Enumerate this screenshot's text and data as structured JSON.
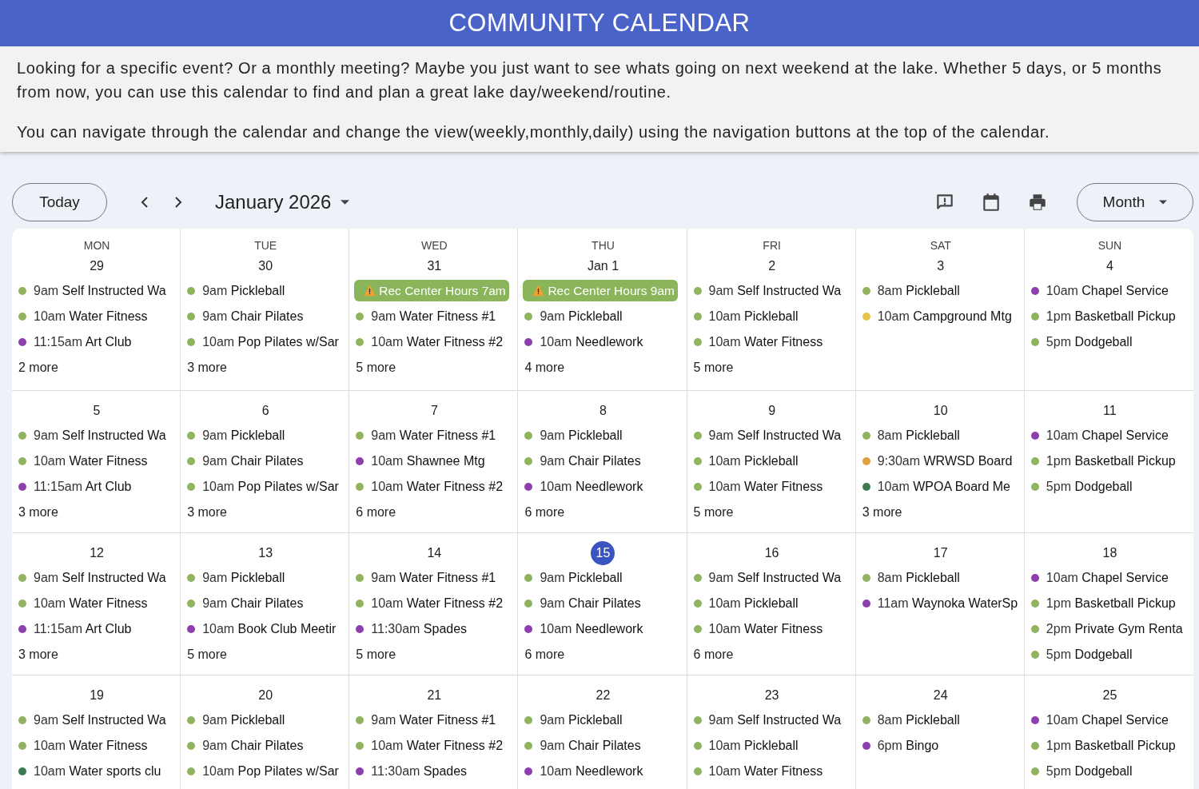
{
  "header": {
    "title": "COMMUNITY CALENDAR"
  },
  "intro": {
    "paragraphs": [
      "Looking for a specific event? Or a monthly meeting? Maybe you just want to see whats going on next weekend at the lake. Whether 5 days, or 5 months from now, you can use this calendar to find and plan a great lake day/weekend/routine.",
      "You can navigate through the calendar and change the view(weekly,monthly,daily) using the navigation buttons at the top of the calendar."
    ]
  },
  "toolbar": {
    "today_button": "Today",
    "month_title": "January 2026",
    "view_button": "Month"
  },
  "weekdays": [
    "MON",
    "TUE",
    "WED",
    "THU",
    "FRI",
    "SAT",
    "SUN"
  ],
  "weeks": [
    {
      "days": [
        {
          "date": "29",
          "today": false,
          "more": "2 more",
          "events": [
            {
              "kind": "dot",
              "color": "#8fb35f",
              "time": "9am",
              "title": "Self Instructed Wa"
            },
            {
              "kind": "dot",
              "color": "#8fb35f",
              "time": "10am",
              "title": "Water Fitness"
            },
            {
              "kind": "dot",
              "color": "#8e3fae",
              "time": "11:15am",
              "title": "Art Club"
            }
          ]
        },
        {
          "date": "30",
          "today": false,
          "more": "3 more",
          "events": [
            {
              "kind": "dot",
              "color": "#8fb35f",
              "time": "9am",
              "title": "Pickleball"
            },
            {
              "kind": "dot",
              "color": "#8fb35f",
              "time": "9am",
              "title": "Chair Pilates"
            },
            {
              "kind": "dot",
              "color": "#8fb35f",
              "time": "10am",
              "title": "Pop Pilates w/Sar"
            }
          ]
        },
        {
          "date": "31",
          "today": false,
          "more": "5 more",
          "events": [
            {
              "kind": "chip",
              "color": "#8bb55a",
              "title": "Rec Center Hours 7am"
            },
            {
              "kind": "dot",
              "color": "#8fb35f",
              "time": "9am",
              "title": "Water Fitness #1"
            },
            {
              "kind": "dot",
              "color": "#8fb35f",
              "time": "10am",
              "title": "Water Fitness #2"
            }
          ]
        },
        {
          "date": "Jan 1",
          "today": false,
          "more": "4 more",
          "events": [
            {
              "kind": "chip",
              "color": "#8bb55a",
              "title": "Rec Center Hours 9am"
            },
            {
              "kind": "dot",
              "color": "#8fb35f",
              "time": "9am",
              "title": "Pickleball"
            },
            {
              "kind": "dot",
              "color": "#8e3fae",
              "time": "10am",
              "title": "Needlework"
            }
          ]
        },
        {
          "date": "2",
          "today": false,
          "more": "5 more",
          "events": [
            {
              "kind": "dot",
              "color": "#8fb35f",
              "time": "9am",
              "title": "Self Instructed Wa"
            },
            {
              "kind": "dot",
              "color": "#8fb35f",
              "time": "10am",
              "title": "Pickleball"
            },
            {
              "kind": "dot",
              "color": "#8fb35f",
              "time": "10am",
              "title": "Water Fitness"
            }
          ]
        },
        {
          "date": "3",
          "today": false,
          "events": [
            {
              "kind": "dot",
              "color": "#8fb35f",
              "time": "8am",
              "title": "Pickleball"
            },
            {
              "kind": "dot",
              "color": "#e8c24a",
              "time": "10am",
              "title": "Campground Mtg"
            }
          ]
        },
        {
          "date": "4",
          "today": false,
          "events": [
            {
              "kind": "dot",
              "color": "#8e3fae",
              "time": "10am",
              "title": "Chapel Service"
            },
            {
              "kind": "dot",
              "color": "#8fb35f",
              "time": "1pm",
              "title": "Basketball Pickup"
            },
            {
              "kind": "dot",
              "color": "#8fb35f",
              "time": "5pm",
              "title": "Dodgeball"
            }
          ]
        }
      ]
    },
    {
      "days": [
        {
          "date": "5",
          "today": false,
          "more": "3 more",
          "events": [
            {
              "kind": "dot",
              "color": "#8fb35f",
              "time": "9am",
              "title": "Self Instructed Wa"
            },
            {
              "kind": "dot",
              "color": "#8fb35f",
              "time": "10am",
              "title": "Water Fitness"
            },
            {
              "kind": "dot",
              "color": "#8e3fae",
              "time": "11:15am",
              "title": "Art Club"
            }
          ]
        },
        {
          "date": "6",
          "today": false,
          "more": "3 more",
          "events": [
            {
              "kind": "dot",
              "color": "#8fb35f",
              "time": "9am",
              "title": "Pickleball"
            },
            {
              "kind": "dot",
              "color": "#8fb35f",
              "time": "9am",
              "title": "Chair Pilates"
            },
            {
              "kind": "dot",
              "color": "#8fb35f",
              "time": "10am",
              "title": "Pop Pilates w/Sar"
            }
          ]
        },
        {
          "date": "7",
          "today": false,
          "more": "6 more",
          "events": [
            {
              "kind": "dot",
              "color": "#8fb35f",
              "time": "9am",
              "title": "Water Fitness #1"
            },
            {
              "kind": "dot",
              "color": "#8e3fae",
              "time": "10am",
              "title": "Shawnee Mtg"
            },
            {
              "kind": "dot",
              "color": "#8fb35f",
              "time": "10am",
              "title": "Water Fitness #2"
            }
          ]
        },
        {
          "date": "8",
          "today": false,
          "more": "6 more",
          "events": [
            {
              "kind": "dot",
              "color": "#8fb35f",
              "time": "9am",
              "title": "Pickleball"
            },
            {
              "kind": "dot",
              "color": "#8fb35f",
              "time": "9am",
              "title": "Chair Pilates"
            },
            {
              "kind": "dot",
              "color": "#8e3fae",
              "time": "10am",
              "title": "Needlework"
            }
          ]
        },
        {
          "date": "9",
          "today": false,
          "more": "5 more",
          "events": [
            {
              "kind": "dot",
              "color": "#8fb35f",
              "time": "9am",
              "title": "Self Instructed Wa"
            },
            {
              "kind": "dot",
              "color": "#8fb35f",
              "time": "10am",
              "title": "Pickleball"
            },
            {
              "kind": "dot",
              "color": "#8fb35f",
              "time": "10am",
              "title": "Water Fitness"
            }
          ]
        },
        {
          "date": "10",
          "today": false,
          "more": "3 more",
          "events": [
            {
              "kind": "dot",
              "color": "#8fb35f",
              "time": "8am",
              "title": "Pickleball"
            },
            {
              "kind": "dot",
              "color": "#e0a040",
              "time": "9:30am",
              "title": "WRWSD Board"
            },
            {
              "kind": "dot",
              "color": "#3d7a4f",
              "time": "10am",
              "title": "WPOA Board Me"
            }
          ]
        },
        {
          "date": "11",
          "today": false,
          "events": [
            {
              "kind": "dot",
              "color": "#8e3fae",
              "time": "10am",
              "title": "Chapel Service"
            },
            {
              "kind": "dot",
              "color": "#8fb35f",
              "time": "1pm",
              "title": "Basketball Pickup"
            },
            {
              "kind": "dot",
              "color": "#8fb35f",
              "time": "5pm",
              "title": "Dodgeball"
            }
          ]
        }
      ]
    },
    {
      "days": [
        {
          "date": "12",
          "today": false,
          "more": "3 more",
          "events": [
            {
              "kind": "dot",
              "color": "#8fb35f",
              "time": "9am",
              "title": "Self Instructed Wa"
            },
            {
              "kind": "dot",
              "color": "#8fb35f",
              "time": "10am",
              "title": "Water Fitness"
            },
            {
              "kind": "dot",
              "color": "#8e3fae",
              "time": "11:15am",
              "title": "Art Club"
            }
          ]
        },
        {
          "date": "13",
          "today": false,
          "more": "5 more",
          "events": [
            {
              "kind": "dot",
              "color": "#8fb35f",
              "time": "9am",
              "title": "Pickleball"
            },
            {
              "kind": "dot",
              "color": "#8fb35f",
              "time": "9am",
              "title": "Chair Pilates"
            },
            {
              "kind": "dot",
              "color": "#8e3fae",
              "time": "10am",
              "title": "Book Club Meetir"
            }
          ]
        },
        {
          "date": "14",
          "today": false,
          "more": "5 more",
          "events": [
            {
              "kind": "dot",
              "color": "#8fb35f",
              "time": "9am",
              "title": "Water Fitness #1"
            },
            {
              "kind": "dot",
              "color": "#8fb35f",
              "time": "10am",
              "title": "Water Fitness #2"
            },
            {
              "kind": "dot",
              "color": "#8e3fae",
              "time": "11:30am",
              "title": "Spades"
            }
          ]
        },
        {
          "date": "15",
          "today": true,
          "more": "6 more",
          "events": [
            {
              "kind": "dot",
              "color": "#8fb35f",
              "time": "9am",
              "title": "Pickleball"
            },
            {
              "kind": "dot",
              "color": "#8fb35f",
              "time": "9am",
              "title": "Chair Pilates"
            },
            {
              "kind": "dot",
              "color": "#8e3fae",
              "time": "10am",
              "title": "Needlework"
            }
          ]
        },
        {
          "date": "16",
          "today": false,
          "more": "6 more",
          "events": [
            {
              "kind": "dot",
              "color": "#8fb35f",
              "time": "9am",
              "title": "Self Instructed Wa"
            },
            {
              "kind": "dot",
              "color": "#8fb35f",
              "time": "10am",
              "title": "Pickleball"
            },
            {
              "kind": "dot",
              "color": "#8fb35f",
              "time": "10am",
              "title": "Water Fitness"
            }
          ]
        },
        {
          "date": "17",
          "today": false,
          "events": [
            {
              "kind": "dot",
              "color": "#8fb35f",
              "time": "8am",
              "title": "Pickleball"
            },
            {
              "kind": "dot",
              "color": "#8e3fae",
              "time": "11am",
              "title": "Waynoka WaterSp"
            }
          ]
        },
        {
          "date": "18",
          "today": false,
          "events": [
            {
              "kind": "dot",
              "color": "#8e3fae",
              "time": "10am",
              "title": "Chapel Service"
            },
            {
              "kind": "dot",
              "color": "#8fb35f",
              "time": "1pm",
              "title": "Basketball Pickup"
            },
            {
              "kind": "dot",
              "color": "#8fb35f",
              "time": "2pm",
              "title": "Private Gym Renta"
            },
            {
              "kind": "dot",
              "color": "#8fb35f",
              "time": "5pm",
              "title": "Dodgeball"
            }
          ]
        }
      ]
    },
    {
      "days": [
        {
          "date": "19",
          "today": false,
          "events": [
            {
              "kind": "dot",
              "color": "#8fb35f",
              "time": "9am",
              "title": "Self Instructed Wa"
            },
            {
              "kind": "dot",
              "color": "#8fb35f",
              "time": "10am",
              "title": "Water Fitness"
            },
            {
              "kind": "dot",
              "color": "#3d7a4f",
              "time": "10am",
              "title": "Water sports clu"
            }
          ]
        },
        {
          "date": "20",
          "today": false,
          "events": [
            {
              "kind": "dot",
              "color": "#8fb35f",
              "time": "9am",
              "title": "Pickleball"
            },
            {
              "kind": "dot",
              "color": "#8fb35f",
              "time": "9am",
              "title": "Chair Pilates"
            },
            {
              "kind": "dot",
              "color": "#8fb35f",
              "time": "10am",
              "title": "Pop Pilates w/Sar"
            }
          ]
        },
        {
          "date": "21",
          "today": false,
          "events": [
            {
              "kind": "dot",
              "color": "#8fb35f",
              "time": "9am",
              "title": "Water Fitness #1"
            },
            {
              "kind": "dot",
              "color": "#8fb35f",
              "time": "10am",
              "title": "Water Fitness #2"
            },
            {
              "kind": "dot",
              "color": "#8e3fae",
              "time": "11:30am",
              "title": "Spades"
            }
          ]
        },
        {
          "date": "22",
          "today": false,
          "events": [
            {
              "kind": "dot",
              "color": "#8fb35f",
              "time": "9am",
              "title": "Pickleball"
            },
            {
              "kind": "dot",
              "color": "#8fb35f",
              "time": "9am",
              "title": "Chair Pilates"
            },
            {
              "kind": "dot",
              "color": "#8e3fae",
              "time": "10am",
              "title": "Needlework"
            }
          ]
        },
        {
          "date": "23",
          "today": false,
          "events": [
            {
              "kind": "dot",
              "color": "#8fb35f",
              "time": "9am",
              "title": "Self Instructed Wa"
            },
            {
              "kind": "dot",
              "color": "#8fb35f",
              "time": "10am",
              "title": "Pickleball"
            },
            {
              "kind": "dot",
              "color": "#8fb35f",
              "time": "10am",
              "title": "Water Fitness"
            }
          ]
        },
        {
          "date": "24",
          "today": false,
          "events": [
            {
              "kind": "dot",
              "color": "#8fb35f",
              "time": "8am",
              "title": "Pickleball"
            },
            {
              "kind": "dot",
              "color": "#8e3fae",
              "time": "6pm",
              "title": "Bingo"
            }
          ]
        },
        {
          "date": "25",
          "today": false,
          "events": [
            {
              "kind": "dot",
              "color": "#8e3fae",
              "time": "10am",
              "title": "Chapel Service"
            },
            {
              "kind": "dot",
              "color": "#8fb35f",
              "time": "1pm",
              "title": "Basketball Pickup"
            },
            {
              "kind": "dot",
              "color": "#8fb35f",
              "time": "5pm",
              "title": "Dodgeball"
            }
          ]
        }
      ]
    }
  ]
}
